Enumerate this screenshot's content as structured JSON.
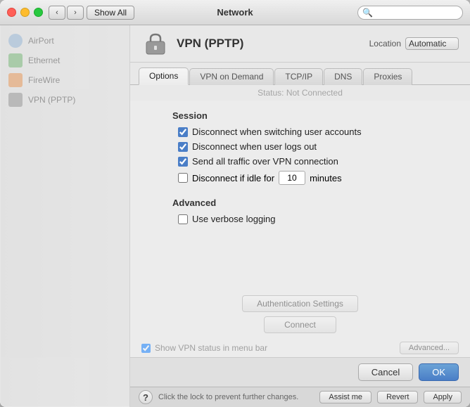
{
  "window": {
    "title": "Network",
    "traffic_lights": [
      "close",
      "minimize",
      "maximize"
    ],
    "show_all_label": "Show All",
    "search_placeholder": ""
  },
  "vpn_header": {
    "icon": "🔒",
    "title": "VPN (PPTP)",
    "location_label": "Location",
    "location_value": "Automatic"
  },
  "tabs": [
    {
      "id": "options",
      "label": "Options",
      "active": true
    },
    {
      "id": "vpn-on-demand",
      "label": "VPN on Demand",
      "active": false
    },
    {
      "id": "tcp-ip",
      "label": "TCP/IP",
      "active": false
    },
    {
      "id": "dns",
      "label": "DNS",
      "active": false
    },
    {
      "id": "proxies",
      "label": "Proxies",
      "active": false
    }
  ],
  "status": {
    "text": "Status:  Not Connected"
  },
  "options": {
    "session_label": "Session",
    "checkboxes": [
      {
        "id": "disconnect-switch",
        "label": "Disconnect when switching user accounts",
        "checked": true
      },
      {
        "id": "disconnect-logout",
        "label": "Disconnect when user logs out",
        "checked": true
      },
      {
        "id": "send-all-traffic",
        "label": "Send all traffic over VPN connection",
        "checked": true
      }
    ],
    "idle_checkbox": {
      "id": "disconnect-idle",
      "label": "Disconnect if idle for",
      "checked": false
    },
    "idle_minutes": "10",
    "idle_suffix": "minutes",
    "advanced_label": "Advanced",
    "verbose_checkbox": {
      "id": "verbose-logging",
      "label": "Use verbose logging",
      "checked": false
    }
  },
  "auth_button_label": "Authentication Settings",
  "connect_button_label": "Connect",
  "show_vpn_status_label": "Show VPN status in menu bar",
  "advanced_button_label": "Advanced...",
  "bottom_bar": {
    "help_label": "?",
    "lock_label": "Click the lock to prevent further changes.",
    "assist_me_label": "Assist me",
    "revert_label": "Revert",
    "apply_label": "Apply"
  },
  "dialog": {
    "cancel_label": "Cancel",
    "ok_label": "OK"
  },
  "sidebar": {
    "items": [
      {
        "label": "AirPort"
      },
      {
        "label": "Ethernet"
      },
      {
        "label": "FireWire"
      },
      {
        "label": "VPN (PPTP)"
      }
    ]
  }
}
